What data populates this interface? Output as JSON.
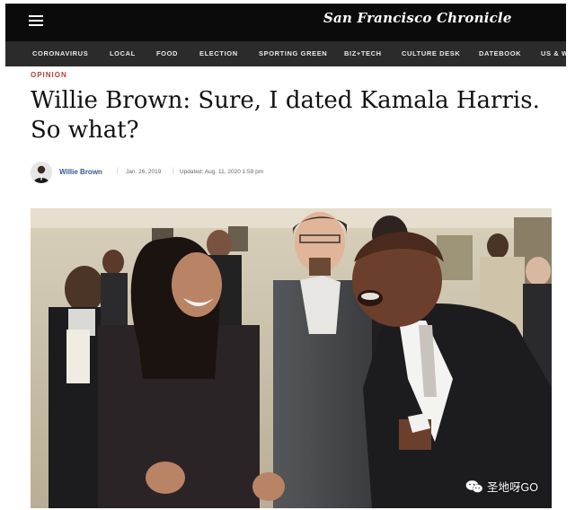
{
  "header": {
    "masthead": "San Francisco Chronicle",
    "menu_icon": "hamburger-icon"
  },
  "nav": {
    "items": [
      "CORONAVIRUS",
      "LOCAL",
      "FOOD",
      "ELECTION",
      "SPORTING GREEN",
      "BIZ+TECH",
      "CULTURE DESK",
      "DATEBOOK",
      "US & W"
    ]
  },
  "article": {
    "section": "OPINION",
    "headline": "Willie Brown: Sure, I dated Kamala Harris. So what?",
    "author": "Willie Brown",
    "published": "Jan. 26, 2019",
    "updated": "Updated: Aug. 11, 2020 1:59 pm"
  },
  "watermark": {
    "text": "圣地呀GO",
    "icon": "wechat-icon"
  },
  "colors": {
    "topbar": "#0b0b0b",
    "navbar": "#2b2b2b",
    "section": "#b3413a",
    "author_link": "#39598e"
  }
}
